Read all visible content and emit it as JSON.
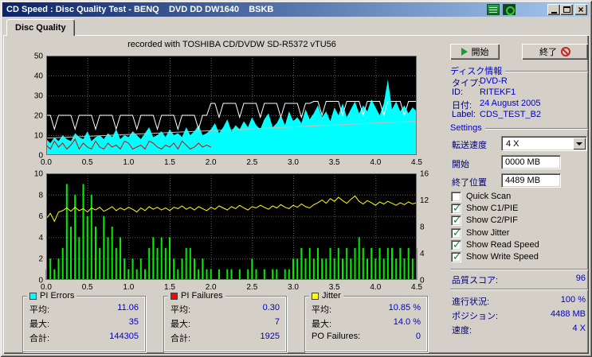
{
  "window": {
    "title": "CD Speed : Disc Quality Test - BENQ    DVD DD DW1640    BSKB"
  },
  "tabs": {
    "disc_quality": "Disc Quality"
  },
  "chart_header": "recorded with TOSHIBA CD/DVDW SD-R5372 vTU56",
  "actions": {
    "start": "開始",
    "exit": "終了"
  },
  "disc_info": {
    "title": "ディスク情報",
    "rows": [
      {
        "label": "タイプ:",
        "value": "DVD-R"
      },
      {
        "label": "ID:",
        "value": "RITEKF1"
      },
      {
        "label": "日付:",
        "value": "24 August 2005"
      },
      {
        "label": "Label:",
        "value": "CDS_TEST_B2"
      }
    ]
  },
  "settings": {
    "title": "Settings",
    "speed_label": "転送速度",
    "speed_value": "4 X",
    "start_label": "開始",
    "start_value": "0000 MB",
    "end_label": "終了位置",
    "end_value": "4489 MB",
    "checkboxes": [
      {
        "label": "Quick Scan",
        "checked": false
      },
      {
        "label": "Show C1/PIE",
        "checked": true
      },
      {
        "label": "Show C2/PIF",
        "checked": true
      },
      {
        "label": "Show Jitter",
        "checked": true
      },
      {
        "label": "Show Read Speed",
        "checked": true
      },
      {
        "label": "Show Write Speed",
        "checked": true
      }
    ],
    "quality_label": "品質スコア:",
    "quality_value": "96",
    "progress_label": "進行状況:",
    "progress_value": "100 %",
    "position_label": "ポジション:",
    "position_value": "4488 MB",
    "speed2_label": "速度:",
    "speed2_value": "4 X"
  },
  "stats": [
    {
      "title": "PI Errors",
      "color": "#00ffff",
      "rows": [
        {
          "label": "平均:",
          "value": "11.06"
        },
        {
          "label": "最大:",
          "value": "35"
        },
        {
          "label": "合計:",
          "value": "144305"
        }
      ]
    },
    {
      "title": "PI Failures",
      "color": "#ff0000",
      "rows": [
        {
          "label": "平均:",
          "value": "0.30"
        },
        {
          "label": "最大:",
          "value": "7"
        },
        {
          "label": "合計:",
          "value": "1925"
        }
      ]
    },
    {
      "title": "Jitter",
      "color": "#ffff00",
      "rows": [
        {
          "label": "平均:",
          "value": "10.85 %"
        },
        {
          "label": "最大:",
          "value": "14.0 %"
        },
        {
          "label": "PO Failures:",
          "value": "0"
        }
      ]
    }
  ],
  "colors": {
    "titlebar_left": "#0a246a",
    "titlebar_right": "#a6caf0",
    "check": "#008a2e"
  },
  "icons": {
    "titlebar": [
      "chart-tray-icon",
      "disc-tray-icon",
      "minimize-icon",
      "maximize-icon",
      "close-icon"
    ],
    "start_button": "play-icon",
    "exit_button": "stop-icon",
    "speed_select": "chevron-down-icon"
  },
  "chart_data": [
    {
      "type": "area",
      "name": "pie-errors-chart",
      "x_range": [
        0,
        4.5
      ],
      "x_step": 0.05,
      "x_ticks": [
        "0.0",
        "0.5",
        "1.0",
        "1.5",
        "2.0",
        "2.5",
        "3.0",
        "3.5",
        "4.0",
        "4.5"
      ],
      "y_left": {
        "range": [
          0,
          50
        ],
        "ticks": [
          0,
          10,
          20,
          30,
          40,
          50
        ]
      },
      "series": [
        {
          "name": "C1/PIE errors",
          "style": "area",
          "color": "#00ffff",
          "values": [
            8,
            6,
            9,
            7,
            10,
            8,
            7,
            11,
            9,
            8,
            12,
            7,
            9,
            10,
            8,
            11,
            9,
            13,
            8,
            10,
            9,
            12,
            10,
            8,
            11,
            14,
            9,
            10,
            12,
            9,
            13,
            10,
            11,
            9,
            14,
            10,
            12,
            15,
            10,
            11,
            13,
            16,
            11,
            14,
            18,
            12,
            15,
            13,
            17,
            14,
            19,
            15,
            13,
            18,
            21,
            14,
            16,
            20,
            15,
            22,
            17,
            19,
            16,
            23,
            18,
            21,
            25,
            19,
            22,
            17,
            24,
            20,
            26,
            19,
            23,
            27,
            21,
            25,
            22,
            28,
            24,
            20,
            26,
            38,
            23,
            27,
            22,
            25,
            21,
            24,
            22
          ]
        },
        {
          "name": "C2/PIF overlay",
          "style": "line",
          "color": "#dd0000",
          "values": [
            5,
            3,
            7,
            4,
            6,
            3,
            5,
            8,
            3,
            6,
            4,
            3,
            7,
            4,
            3,
            6,
            4,
            5,
            3,
            7,
            6,
            3,
            4,
            5,
            3,
            7,
            6,
            4,
            3,
            5,
            4,
            6,
            3,
            7,
            5,
            3,
            4,
            6,
            4,
            5,
            4
          ]
        },
        {
          "name": "read speed",
          "style": "line",
          "color": "#c0c0c0",
          "x": [
            0,
            4.5
          ],
          "values": [
            8.5,
            17
          ]
        },
        {
          "name": "write speed",
          "style": "line",
          "color": "#ffffff",
          "values": [
            20,
            20,
            13,
            20,
            20,
            20,
            20,
            13,
            20,
            20,
            20,
            20,
            13,
            20,
            20,
            20,
            20,
            13,
            20,
            20,
            20,
            20,
            13,
            20,
            20,
            20,
            20,
            13,
            20,
            20,
            20,
            20,
            13,
            20,
            20,
            20,
            20,
            13,
            20,
            20,
            26,
            26,
            19,
            26,
            26,
            26,
            26,
            19,
            26,
            26,
            26,
            26,
            19,
            26,
            26,
            26,
            26,
            19,
            26,
            26,
            26,
            26,
            19,
            26,
            26,
            27,
            27,
            20,
            27,
            27,
            27,
            27,
            20,
            27,
            27,
            27,
            27,
            20,
            27,
            27,
            27,
            27,
            20,
            27,
            27,
            27,
            27,
            20,
            27,
            27,
            27
          ]
        }
      ]
    },
    {
      "type": "bar",
      "name": "pif-jitter-chart",
      "x_range": [
        0,
        4.5
      ],
      "x_step": 0.05,
      "x_ticks": [
        "0.0",
        "0.5",
        "1.0",
        "1.5",
        "2.0",
        "2.5",
        "3.0",
        "3.5",
        "4.0",
        "4.5"
      ],
      "y_left": {
        "range": [
          0,
          10
        ],
        "ticks": [
          0,
          2,
          4,
          6,
          8,
          10
        ]
      },
      "y_right": {
        "range": [
          0,
          16
        ],
        "ticks": [
          0,
          4,
          8,
          12,
          16
        ]
      },
      "series": [
        {
          "name": "PI failures",
          "style": "bars",
          "color": "#00ee00",
          "values": [
            1,
            2,
            1,
            2,
            3,
            9,
            5,
            8,
            4,
            9,
            6,
            8,
            5,
            3,
            6,
            4,
            5,
            3,
            4,
            2,
            1,
            2,
            1,
            2,
            1,
            3,
            4,
            3,
            4,
            3,
            4,
            2,
            1,
            2,
            3,
            3,
            2,
            1,
            2,
            1,
            1,
            0,
            1,
            0,
            1,
            1,
            0,
            1,
            0,
            1,
            2,
            1,
            0,
            1,
            0,
            1,
            1,
            0,
            1,
            1,
            2,
            2,
            3,
            2,
            3,
            2,
            3,
            2,
            2,
            3,
            2,
            3,
            2,
            3,
            2,
            3,
            4,
            3,
            2,
            3,
            2,
            3,
            2,
            3,
            3,
            2,
            3,
            2,
            3,
            2,
            3
          ]
        },
        {
          "name": "jitter %",
          "style": "line",
          "color": "#ffff00",
          "axis": "right",
          "values": [
            9.2,
            10.0,
            8.8,
            10.2,
            10.4,
            10.8,
            10.3,
            10.9,
            10.4,
            10.7,
            10.2,
            10.8,
            10.5,
            10.9,
            10.3,
            10.6,
            11.0,
            10.4,
            10.8,
            10.5,
            10.9,
            10.6,
            10.2,
            10.8,
            10.4,
            11.0,
            10.6,
            10.9,
            10.5,
            10.8,
            10.4,
            10.9,
            10.7,
            11.1,
            10.6,
            10.9,
            10.5,
            11.0,
            10.7,
            10.4,
            10.9,
            10.6,
            11.1,
            10.8,
            10.5,
            11.0,
            10.7,
            11.2,
            10.8,
            10.5,
            11.0,
            10.8,
            11.2,
            10.9,
            10.6,
            11.1,
            10.8,
            11.3,
            10.9,
            10.7,
            11.2,
            10.9,
            11.4,
            11.0,
            10.8,
            11.3,
            11.6,
            12.0,
            11.5,
            12.2,
            11.8,
            12.4,
            11.9,
            11.5,
            12.1,
            12.6,
            11.8,
            11.4,
            11.9,
            11.6,
            11.2,
            11.7,
            11.4,
            11.8,
            11.5,
            11.2,
            11.6,
            11.3,
            11.7,
            11.4,
            11.6
          ]
        }
      ]
    }
  ]
}
